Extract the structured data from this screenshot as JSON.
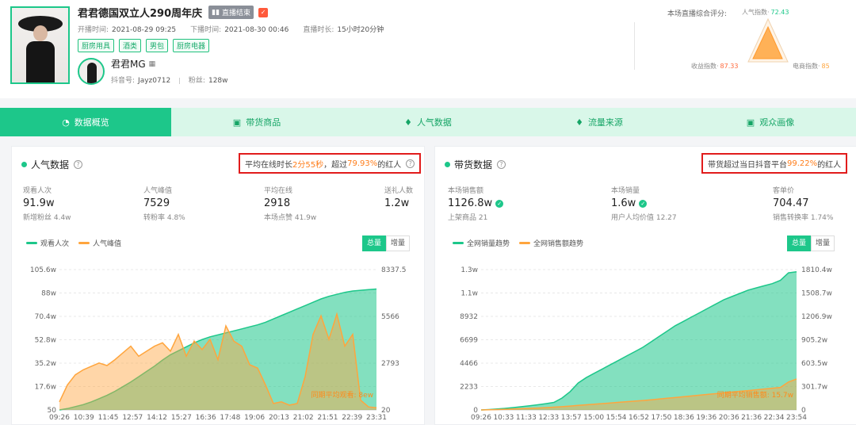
{
  "header": {
    "title": "君君德国双立人290周年庆",
    "live_status": "直播结束",
    "start_label": "开播时间:",
    "start_value": "2021-08-29 09:25",
    "end_label": "下播时间:",
    "end_value": "2021-08-30 00:46",
    "duration_label": "直播时长:",
    "duration_value": "15小时20分钟",
    "tags": [
      "厨房用具",
      "酒类",
      "男包",
      "厨房电器"
    ],
    "host_name": "君君MG",
    "douyin_label": "抖音号:",
    "douyin_value": "Jayz0712",
    "fans_label": "粉丝:",
    "fans_value": "128w"
  },
  "score": {
    "title": "本场直播综合评分:",
    "popularity_label": "人气指数·",
    "popularity_value": "72.43",
    "revenue_label": "收益指数·",
    "revenue_value": "87.33",
    "ecommerce_label": "电商指数·",
    "ecommerce_value": "85"
  },
  "tabs": [
    "数据概览",
    "带货商品",
    "人气数据",
    "流量来源",
    "观众画像"
  ],
  "popularity": {
    "title": "人气数据",
    "highlight_prefix": "平均在线时长 ",
    "highlight_value1": "2分55秒",
    "highlight_mid": "，超过 ",
    "highlight_value2": "79.93%",
    "highlight_suffix": "的红人",
    "metrics": [
      {
        "label": "观看人次",
        "value": "91.9w",
        "sub": "新增粉丝 4.4w"
      },
      {
        "label": "人气峰值",
        "value": "7529",
        "sub": "转粉率 4.8%"
      },
      {
        "label": "平均在线",
        "value": "2918",
        "sub": "本场点赞 41.9w"
      },
      {
        "label": "送礼人数",
        "value": "1.2w",
        "sub": ""
      }
    ],
    "legend": [
      "观看人次",
      "人气峰值"
    ],
    "toggle": [
      "总量",
      "增量"
    ],
    "annotation": "同期平均观看: 8ew"
  },
  "sales": {
    "title": "带货数据",
    "highlight_prefix": "带货超过当日抖音平台 ",
    "highlight_value": "99.22%",
    "highlight_suffix": "的红人",
    "metrics": [
      {
        "label": "本场销售额",
        "value": "1126.8w",
        "sub": "上架商品 21"
      },
      {
        "label": "本场销量",
        "value": "1.6w",
        "sub": "用户人均价值 12.27"
      },
      {
        "label": "客单价",
        "value": "704.47",
        "sub": "销售转换率 1.74%"
      }
    ],
    "legend": [
      "全网销量趋势",
      "全网销售额趋势"
    ],
    "toggle": [
      "总量",
      "增量"
    ],
    "annotation": "同期平均销售额: 15.7w"
  },
  "colors": {
    "accent": "#1dc78a",
    "orange": "#ffa53d",
    "highlight_border": "#e11c1c",
    "tab_bg": "#d9f7e9"
  },
  "chart_data": [
    {
      "type": "area",
      "x_ticks": [
        "09:26",
        "10:39",
        "11:45",
        "12:57",
        "14:12",
        "15:27",
        "16:36",
        "17:48",
        "19:06",
        "20:13",
        "21:02",
        "21:51",
        "22:39",
        "23:31"
      ],
      "y_left_ticks": [
        "50",
        "17.6w",
        "35.2w",
        "52.8w",
        "70.4w",
        "88w",
        "105.6w"
      ],
      "y_right_ticks": [
        "20",
        "2793",
        "5566",
        "8337.5"
      ],
      "series": [
        {
          "name": "观看人次",
          "axis": "left",
          "unit": "w",
          "values": [
            0,
            1,
            2.5,
            4,
            6,
            8.5,
            11,
            14,
            17.5,
            21,
            25,
            29,
            33,
            37.5,
            41.5,
            44.5,
            47.5,
            50.5,
            53,
            55,
            56.5,
            58,
            59.5,
            61,
            62.5,
            64,
            66,
            68.5,
            71,
            73.5,
            76,
            78.5,
            81,
            83.5,
            85.5,
            87,
            88.5,
            89.5,
            90,
            90.5,
            91
          ]
        },
        {
          "name": "人气峰值",
          "axis": "right",
          "values": [
            500,
            1500,
            2100,
            2400,
            2600,
            2800,
            2650,
            3000,
            3400,
            3800,
            3200,
            3500,
            3800,
            4000,
            3500,
            4500,
            3200,
            4100,
            3600,
            4200,
            3000,
            5000,
            4100,
            3800,
            2700,
            2500,
            1500,
            400,
            500,
            300,
            400,
            2000,
            4500,
            5600,
            4200,
            5700,
            3800,
            4500,
            600,
            200,
            150
          ]
        }
      ],
      "ylim_left": [
        0,
        105.6
      ],
      "ylim_right": [
        20,
        8337.5
      ]
    },
    {
      "type": "area",
      "x_ticks": [
        "09:26",
        "10:33",
        "11:33",
        "12:33",
        "13:57",
        "15:00",
        "15:54",
        "16:52",
        "17:50",
        "18:36",
        "19:36",
        "20:36",
        "21:36",
        "22:34",
        "23:54"
      ],
      "y_left_ticks": [
        "0",
        "2233",
        "4466",
        "6699",
        "8932",
        "1.1w",
        "1.3w"
      ],
      "y_right_ticks": [
        "0",
        "301.7w",
        "603.5w",
        "905.2w",
        "1206.9w",
        "1508.7w",
        "1810.4w"
      ],
      "series": [
        {
          "name": "全网销量趋势",
          "axis": "left",
          "values": [
            0,
            40,
            90,
            150,
            220,
            300,
            390,
            480,
            580,
            700,
            1100,
            1700,
            2500,
            3000,
            3400,
            3800,
            4200,
            4600,
            5000,
            5400,
            5800,
            6300,
            6800,
            7300,
            7800,
            8200,
            8600,
            9000,
            9400,
            9800,
            10200,
            10500,
            10800,
            11100,
            11300,
            11500,
            11700,
            12000,
            12700,
            12800
          ]
        },
        {
          "name": "全网销售额趋势",
          "axis": "right",
          "unit": "w",
          "values": [
            0,
            2,
            5,
            8,
            12,
            16,
            20,
            25,
            30,
            36,
            42,
            50,
            58,
            66,
            74,
            82,
            90,
            98,
            106,
            114,
            122,
            130,
            140,
            150,
            160,
            170,
            180,
            190,
            200,
            210,
            220,
            230,
            240,
            250,
            260,
            270,
            280,
            290,
            360,
            400
          ]
        }
      ],
      "ylim_left": [
        0,
        13000
      ],
      "ylim_right": [
        0,
        1810.4
      ]
    }
  ]
}
